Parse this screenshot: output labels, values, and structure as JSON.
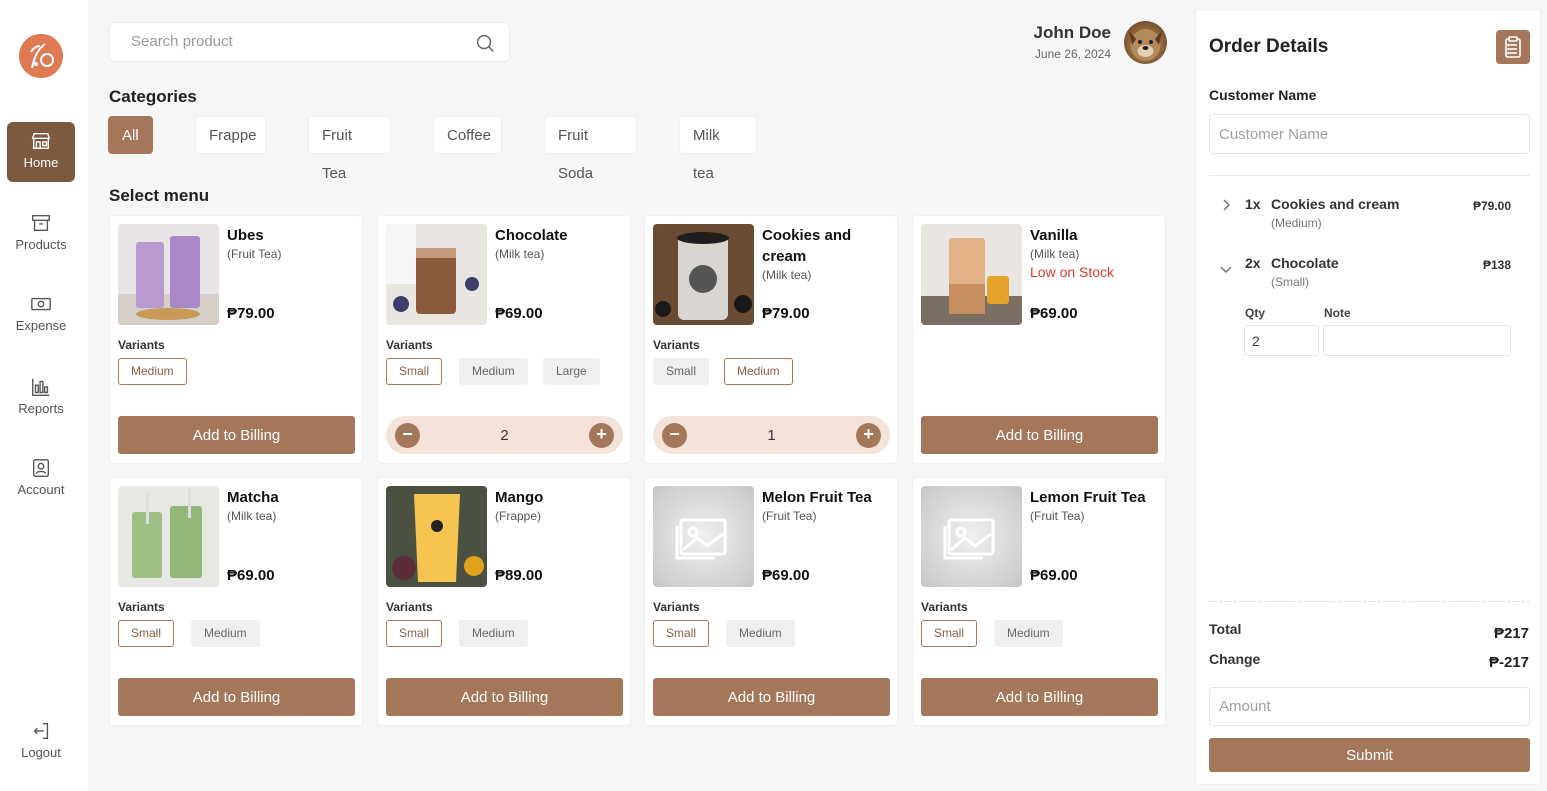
{
  "sidebar": {
    "items": [
      {
        "label": "Home",
        "icon": "store-icon",
        "active": true
      },
      {
        "label": "Products",
        "icon": "archive-box-icon"
      },
      {
        "label": "Expense",
        "icon": "banknote-icon"
      },
      {
        "label": "Reports",
        "icon": "bar-chart-icon"
      },
      {
        "label": "Account",
        "icon": "user-badge-icon"
      }
    ],
    "logout_label": "Logout"
  },
  "search": {
    "placeholder": "Search product"
  },
  "user": {
    "name": "John Doe",
    "date": "June 26, 2024"
  },
  "categories": {
    "title": "Categories",
    "items": [
      "All",
      "Frappe",
      "Fruit Tea",
      "Coffee",
      "Fruit Soda",
      "Milk tea"
    ],
    "active": "All"
  },
  "menu": {
    "title": "Select menu",
    "variants_label": "Variants",
    "add_label": "Add to Billing",
    "products": [
      {
        "name": "Ubes",
        "category": "(Fruit Tea)",
        "price": "₱79.00",
        "variants": [
          "Medium"
        ],
        "selected": "Medium"
      },
      {
        "name": "Chocolate",
        "category": "(Milk tea)",
        "price": "₱69.00",
        "variants": [
          "Small",
          "Medium",
          "Large"
        ],
        "selected": "Small",
        "qty": "2"
      },
      {
        "name": "Cookies and cream",
        "category": "(Milk tea)",
        "price": "₱79.00",
        "variants": [
          "Small",
          "Medium"
        ],
        "selected": "Medium",
        "qty": "1"
      },
      {
        "name": "Vanilla",
        "category": "(Milk tea)",
        "stock_note": "Low on Stock",
        "price": "₱69.00",
        "variants": []
      },
      {
        "name": "Matcha",
        "category": "(Milk tea)",
        "price": "₱69.00",
        "variants": [
          "Small",
          "Medium"
        ],
        "selected": "Small"
      },
      {
        "name": "Mango",
        "category": "(Frappe)",
        "price": "₱89.00",
        "variants": [
          "Small",
          "Medium"
        ],
        "selected": "Small"
      },
      {
        "name": "Melon Fruit Tea",
        "category": "(Fruit Tea)",
        "price": "₱69.00",
        "variants": [
          "Small",
          "Medium"
        ],
        "selected": "Small"
      },
      {
        "name": "Lemon Fruit Tea",
        "category": "(Fruit Tea)",
        "price": "₱69.00",
        "variants": [
          "Small",
          "Medium"
        ],
        "selected": "Small"
      }
    ]
  },
  "order": {
    "title": "Order Details",
    "customer_label": "Customer Name",
    "customer_placeholder": "Customer Name",
    "items": [
      {
        "qty": "1x",
        "name": "Cookies and cream",
        "size": "(Medium)",
        "price": "₱79.00"
      },
      {
        "qty": "2x",
        "name": "Chocolate",
        "size": "(Small)",
        "price": "₱138"
      }
    ],
    "qty_label": "Qty",
    "note_label": "Note",
    "qty_value": "2",
    "total_label": "Total",
    "total_value": "₱217",
    "change_label": "Change",
    "change_value": "₱-217",
    "amount_placeholder": "Amount",
    "submit_label": "Submit"
  },
  "colors": {
    "accent": "#a5775a",
    "accent_dark": "#7d5940",
    "stepper_bg": "#f4e3d9",
    "warning": "#d93b36",
    "logo": "#e07a55"
  }
}
